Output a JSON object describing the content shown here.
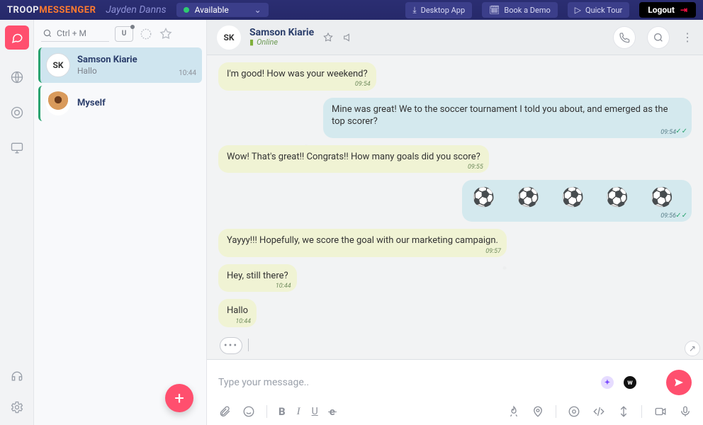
{
  "brand": {
    "part1": "TROOP",
    "part2": "MESSENGER"
  },
  "user": {
    "name": "Jayden Danns",
    "status_label": "Available"
  },
  "top_buttons": {
    "desktop": "Desktop App",
    "demo": "Book a Demo",
    "tour": "Quick Tour",
    "logout": "Logout"
  },
  "search": {
    "placeholder": "Ctrl + M"
  },
  "contacts": [
    {
      "initials": "SK",
      "name": "Samson Kiarie",
      "sub": "Hallo",
      "time": "10:44",
      "active": true,
      "photo": false
    },
    {
      "initials": "",
      "name": "Myself",
      "sub": "",
      "time": "",
      "active": false,
      "photo": true
    }
  ],
  "chat_header": {
    "initials": "SK",
    "name": "Samson Kiarie",
    "status": "Online"
  },
  "messages": [
    {
      "side": "in",
      "text": "I'm good! How was your weekend?",
      "time": "09:54"
    },
    {
      "side": "out",
      "text": "Mine was great! We to the soccer tournament I told you about, and emerged as the top scorer?",
      "time": "09:54",
      "ticks": true
    },
    {
      "side": "in",
      "text": "Wow! That's great!! Congrats!! How many goals did you score?",
      "time": "09:55"
    },
    {
      "side": "out",
      "text": "⚽ ⚽ ⚽ ⚽ ⚽",
      "time": "09:56",
      "ticks": true,
      "emoji": true
    },
    {
      "side": "in",
      "text": "Yayyy!!! Hopefully, we score the goal with our marketing campaign.",
      "time": "09:57"
    },
    {
      "side": "in",
      "text": "Hey, still there?",
      "time": "10:44"
    },
    {
      "side": "in",
      "text": "Hallo",
      "time": "10:44"
    }
  ],
  "composer": {
    "placeholder": "Type your message.."
  }
}
